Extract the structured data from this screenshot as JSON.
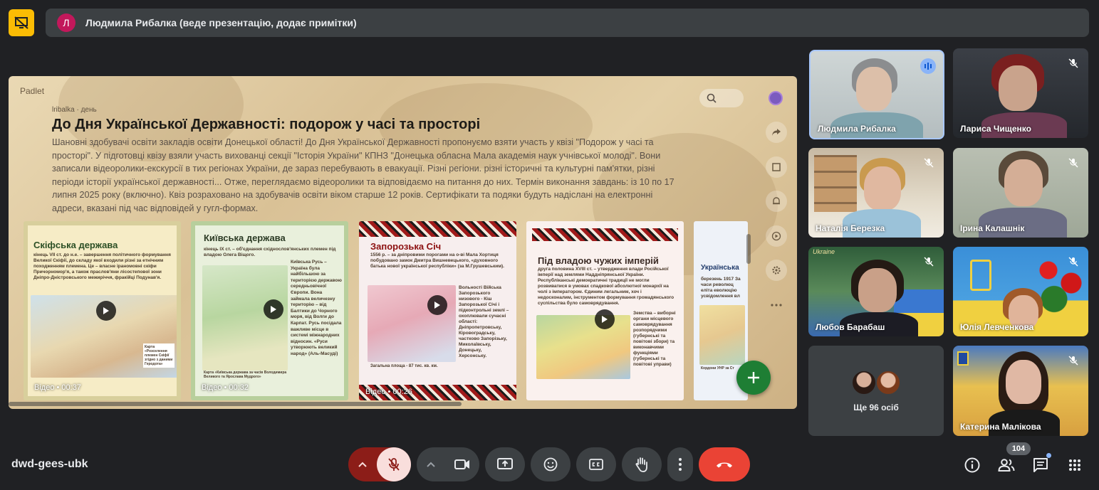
{
  "banner": {
    "avatar_letter": "Л",
    "presenter_text": "Людмила Рибалка (веде презентацію, додає примітки)"
  },
  "presentation": {
    "brand": "Padlet",
    "meta": "lribalka · день",
    "title": "До Дня Української Державності: подорож у часі та просторі",
    "description": "Шановні здобувачі освіти закладів освіти Донецької області! До Дня Української Державності пропонуємо взяти участь у квізі \"Подорож у часі та просторі\". У підготовці квізу взяли участь вихованці секції \"Історія України\" КПНЗ \"Донецька обласна Мала академія наук учнівської молоді\". Вони записали відеоролики-екскурсії в тих регіонах України, де зараз перебувають в евакуації. Різні регіони. різні історичні та культурні пам'ятки, різні періоди історії української державності... Отже, переглядаємо відеоролики та відповідаємо на питання до них. Термін виконання завдань: із 10 по 17 липня 2025 року (включно). Квіз розраховано на здобувачів освіти віком старше 12 років. Сертифікати та подяки будуть надіслані на електронні адреси, вказані під час відповідей у гугл-формах.",
    "cards": [
      {
        "title": "Скіфська держава",
        "body": "кінець VII ст. до н.е. – завершення політичного формування Великої Скіфії, до складу якої входили різні за етнічним походженням племена. Це – власне іраномовні скіфи Причорномор'я, а також праслов'яни лісостепової зони Дніпро-Дністровського межиріччя, фракійці Подунав'я.",
        "caption": "Карта «Розселення племен Скіфії згідно з даними Геродота»",
        "video_label": "Відео • 00:37"
      },
      {
        "title": "Київська держава",
        "body": "кінець IX ст. – об'єднання східнослов'янських племен під владою Олега Віщого.",
        "side_text": "Київська Русь – Україна була найбільшою за територією державою середньовічної Європи. Вона займала величезну територію – від Балтики до Чорного моря, від Волги до Карпат. Русь посідала важливе місце в системі міжнародних відносин. «Руси утворюють великий народ» (Аль-Масуді)",
        "caption": "Карта «Київська держава за часів Володимира Великого та Ярослава Мудрого»",
        "video_label": "Відео • 00:32"
      },
      {
        "title": "Запорозька Січ",
        "body": "1556 р. – за дніпровими порогами на о-ві Мала Хортиця побудовано замок Дмитра Вишневецького, «духовного батька нової української республіки» (за М.Грушевським).",
        "side_text": "Вольності Війська Запорозького низового - Кіш Запорозької Січі і підконтрольні землі – охоплювали сучасні області: Дніпропетровську, Кіровоградську, частково Запорізьку, Миколаївську, Донецьку, Херсонську.",
        "caption": "Загальна площа - 87 тис. кв. км.",
        "video_label": "Відео • 00:26"
      },
      {
        "title": "Під владою чужих імперій",
        "body": "друга половина XVIII ст. – утвердження влади Російської імперії над землями Наддніпрянської України. Республіканські демократичні традиції не могли розвиватися в умовах спадкової абсолютної монархії на чолі з імператором. Єдиним легальним, хоч і недосконалим, інструментом формування громадянського суспільства було самоврядування.",
        "side_text": "Земства – виборні органи місцевого самоврядування розпорядчими (губернські та повітові збори) та виконавчими функціями (губернські та повітові управи)"
      },
      {
        "title": "Українська",
        "body": "березень 1917 За часи революц еліта еволюцію усвідомлення вл",
        "caption": "Кордони УНР за Ст"
      }
    ]
  },
  "participants": [
    {
      "name": "Людмила Рибалка",
      "status": "speaking-icon"
    },
    {
      "name": "Лариса Чищенко",
      "status": "mic-off-icon"
    },
    {
      "name": "Наталія Березка",
      "status": "mic-off-icon"
    },
    {
      "name": "Ірина Калашнік",
      "status": "mic-off-icon"
    },
    {
      "name": "Любов Барабаш",
      "status": "mic-off-icon"
    },
    {
      "name": "Юлія Левченкова",
      "status": "mic-off-icon"
    },
    {
      "name": "Ще 96 осіб",
      "status": ""
    },
    {
      "name": "Катерина Малікова",
      "status": "mic-off-icon"
    }
  ],
  "tile_overlays": {
    "lyubov_banner": "Ukraine"
  },
  "meeting": {
    "code": "dwd-gees-ubk",
    "people_count": "104"
  },
  "colors": {
    "banner_icon": "#fbbc04",
    "mic_muted": "#f9dedc",
    "mic_muted_arrow": "#8c1d18",
    "end_call": "#ea4335",
    "control_bg": "#3c4043",
    "add_button": "#1e7e34"
  }
}
